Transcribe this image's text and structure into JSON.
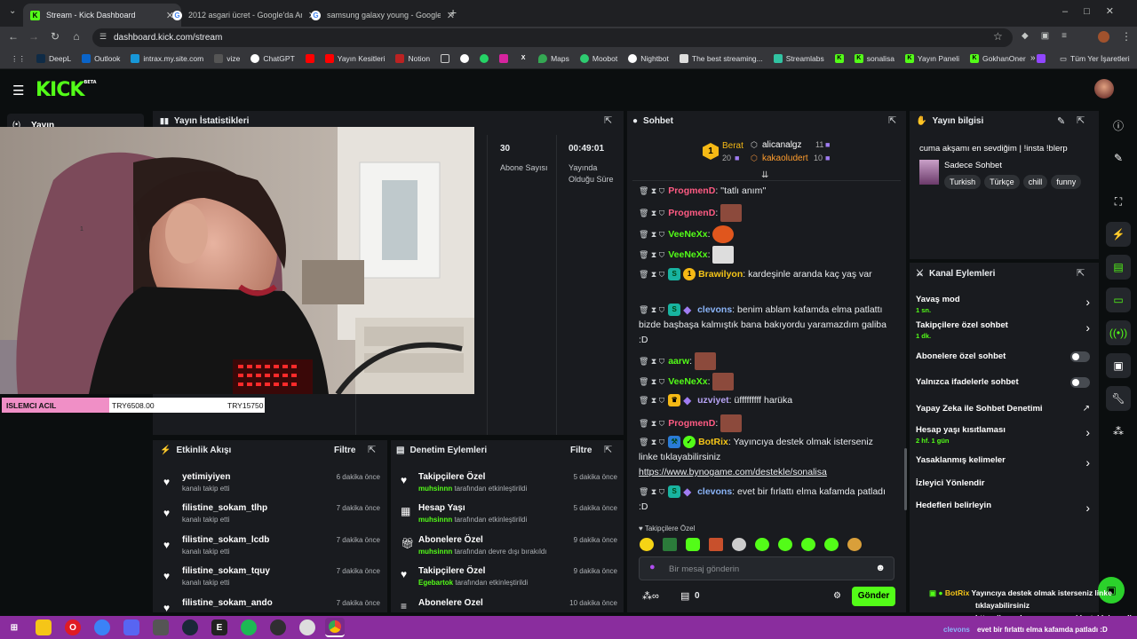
{
  "browser": {
    "tabs": [
      {
        "title": "Stream - Kick Dashboard",
        "icon": "kick-icon"
      },
      {
        "title": "2012 asgari ücret - Google'da Ara",
        "icon": "google-icon"
      },
      {
        "title": "samsung galaxy young - Google'da Ara",
        "icon": "google-icon"
      }
    ],
    "new_tab": "+",
    "url": "dashboard.kick.com/stream",
    "bookmarks": [
      "DeepL",
      "Outlook",
      "intrax.my.site.com",
      "vize",
      "ChatGPT",
      "",
      "Yayın Kesitleri",
      "Notion",
      "",
      "",
      "",
      "",
      "",
      "Maps",
      "Moobot",
      "Nightbot",
      "The best streaming...",
      "Streamlabs",
      "",
      "sonalisa",
      "Yayın Paneli",
      "GokhanOner",
      ""
    ],
    "all_bookmarks": "Tüm Yer İşaretleri"
  },
  "sidebar": {
    "label": "Yayın"
  },
  "stats": {
    "title": "Yayın İstatistikleri",
    "subscribers_value": "30",
    "subscribers_label": "Abone Sayısı",
    "uptime_value": "00:49:01",
    "uptime_label": "Yayında Olduğu Süre"
  },
  "video": {
    "bar_label": "ISLEMCI ACIL",
    "bar_progress": 0.41,
    "bar_value": "TRY6508.00",
    "bar_goal": "TRY15750",
    "note": "1"
  },
  "events": {
    "title": "Etkinlik Akışı",
    "filter": "Filtre",
    "items": [
      {
        "name": "yetimiyiyen",
        "sub": "kanalı takip etti",
        "time": "6 dakika önce"
      },
      {
        "name": "filistine_sokam_tlhp",
        "sub": "kanalı takip etti",
        "time": "7 dakika önce"
      },
      {
        "name": "filistine_sokam_lcdb",
        "sub": "kanalı takip etti",
        "time": "7 dakika önce"
      },
      {
        "name": "filistine_sokam_tquy",
        "sub": "kanalı takip etti",
        "time": "7 dakika önce"
      },
      {
        "name": "filistine_sokam_ando",
        "sub": "",
        "time": "7 dakika önce"
      }
    ]
  },
  "moderation": {
    "title": "Denetim Eylemleri",
    "filter": "Filtre",
    "items": [
      {
        "name": "Takipçilere Özel",
        "user": "muhsinnn",
        "sub": "tarafından etkinleştirildi",
        "time": "5 dakika önce"
      },
      {
        "name": "Hesap Yaşı",
        "user": "muhsinnn",
        "sub": "tarafından etkinleştirildi",
        "time": "5 dakika önce"
      },
      {
        "name": "Abonelere Özel",
        "user": "muhsinnn",
        "sub": "tarafından devre dışı bırakıldı",
        "time": "9 dakika önce"
      },
      {
        "name": "Takipçilere Özel",
        "user": "Egebartok",
        "sub": "tarafından etkinleştirildi",
        "time": "9 dakika önce"
      },
      {
        "name": "Abonelere Özel",
        "user": "",
        "sub": "",
        "time": "10 dakika önce"
      }
    ]
  },
  "chat": {
    "title": "Sohbet",
    "leaderboard": [
      {
        "rank": "1",
        "name": "Berat",
        "count": "20"
      },
      {
        "name": "alicanalgz",
        "count": "11"
      },
      {
        "name": "kakaoludert",
        "count": "10"
      }
    ],
    "messages": [
      {
        "user": "ProgmenD",
        "color": "#ff5b83",
        "text": "''tatlı anım''"
      },
      {
        "user": "ProgmenD",
        "color": "#ff5b83",
        "text": ""
      },
      {
        "user": "VeeNeXx",
        "color": "#53fc18",
        "text": ""
      },
      {
        "user": "VeeNeXx",
        "color": "#53fc18",
        "text": ""
      },
      {
        "user": "Brawilyon",
        "color": "#f5c518",
        "text": "kardeşinle aranda kaç yaş var"
      },
      {
        "user": "clevons",
        "color": "#8ab4f8",
        "text": "benim ablam kafamda elma patlattı bizde başbaşa kalmıştık bana bakıyordu yaramazdım galiba :D"
      },
      {
        "user": "aarw",
        "color": "#53fc18",
        "text": ""
      },
      {
        "user": "VeeNeXx",
        "color": "#53fc18",
        "text": ""
      },
      {
        "user": "uzviyet",
        "color": "#b7a4f5",
        "text": "üfffffffff harüka"
      },
      {
        "user": "ProgmenD",
        "color": "#ff5b83",
        "text": ""
      },
      {
        "user": "BotRix",
        "color": "#f5c518",
        "text": "Yayıncıya destek olmak isterseniz linke tıklayabilirsiniz",
        "link": "https://www.bynogame.com/destekle/sonalisa"
      },
      {
        "user": "clevons",
        "color": "#8ab4f8",
        "text": "evet bir fırlattı elma kafamda patladı :D"
      }
    ],
    "mode_label": "Takipçilere Özel",
    "placeholder": "Bir mesaj gönderin",
    "points": "0",
    "send": "Gönder"
  },
  "stream_info": {
    "title": "Yayın bilgisi",
    "stream_title": "cuma akşamı en sevdiğim | !insta !blerp",
    "category": "Sadece Sohbet",
    "tags": [
      "Turkish",
      "Türkçe",
      "chill",
      "funny"
    ]
  },
  "channel_actions": {
    "title": "Kanal Eylemleri",
    "items": [
      {
        "label": "Yavaş mod",
        "sub": "1 sn.",
        "type": "arrow"
      },
      {
        "label": "Takipçilere özel sohbet",
        "sub": "1 dk.",
        "type": "arrow"
      },
      {
        "label": "Abonelere özel sohbet",
        "sub": "",
        "type": "toggle"
      },
      {
        "label": "Yalnızca ifadelerle sohbet",
        "sub": "",
        "type": "toggle"
      },
      {
        "label": "Yapay Zeka ile Sohbet Denetimi",
        "sub": "",
        "type": "external"
      },
      {
        "label": "Hesap yaşı kısıtlaması",
        "sub": "2 hf. 1 gün",
        "type": "arrow"
      },
      {
        "label": "Yasaklanmış kelimeler",
        "sub": "",
        "type": "arrow"
      },
      {
        "label": "İzleyici Yönlendir",
        "sub": "",
        "type": "none"
      },
      {
        "label": "Hedefleri belirleyin",
        "sub": "",
        "type": "arrow"
      }
    ]
  },
  "overlay": {
    "user": "BotRix",
    "line1": "Yayıncıya destek olmak isterseniz linke",
    "line2": "tıklayabilirsiniz",
    "line3": "https://www.bynogame.com/destekle/sonalisa",
    "user2": "clevons",
    "line4": "evet bir fırlattı elma kafamda patladı :D"
  },
  "colors": {
    "kick_green": "#53fc18",
    "panel": "#191b1f",
    "taskbar": "#8a2d9e"
  }
}
